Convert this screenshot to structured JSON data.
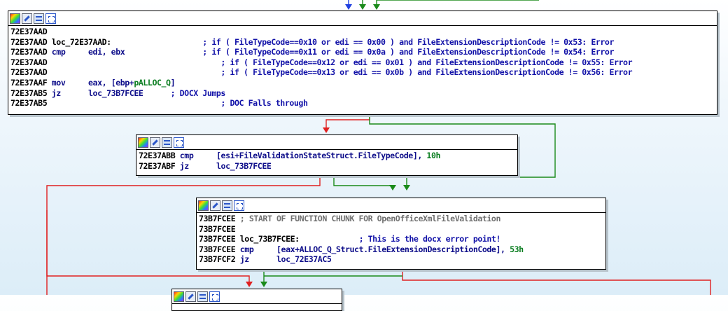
{
  "app": {
    "view": "IDA graph view"
  },
  "colors": {
    "edge_true": "#1a8a1a",
    "edge_false": "#e02020",
    "edge_flow": "#2040e0",
    "comment": "#1212a8",
    "number": "#0a7d20",
    "function_chunk": "#707070"
  },
  "icons": [
    "node-color-icon",
    "rename-node-icon",
    "graph-overview-icon",
    "group-nodes-icon"
  ],
  "nodes": [
    {
      "name": "node-72E37AAD",
      "lines": [
        [
          {
            "t": "72E37AAD"
          }
        ],
        [
          {
            "t": "72E37AAD "
          },
          {
            "t": "loc_72E37AAD:"
          },
          {
            "t": "                    "
          },
          {
            "t": "; if ( FileTypeCode==0x10 or edi == 0x00 ) and FileExtensionDescriptionCode != 0x53: Error",
            "c": "blue"
          }
        ],
        [
          {
            "t": "72E37AAD "
          },
          {
            "t": "cmp",
            "c": "mnem"
          },
          {
            "t": "     edi, ebx",
            "c": "mnem"
          },
          {
            "t": "                 "
          },
          {
            "t": "; if ( FileTypeCode==0x11 or edi == 0x0a ) and FileExtensionDescriptionCode != 0x54: Error",
            "c": "blue"
          }
        ],
        [
          {
            "t": "72E37AAD"
          },
          {
            "t": "                                      "
          },
          {
            "t": "; if ( FileTypeCode==0x12 or edi == 0x01 ) and FileExtensionDescriptionCode != 0x55: Error",
            "c": "blue"
          }
        ],
        [
          {
            "t": "72E37AAD"
          },
          {
            "t": "                                      "
          },
          {
            "t": "; if ( FileTypeCode==0x13 or edi == 0x0b ) and FileExtensionDescriptionCode != 0x56: Error",
            "c": "blue"
          }
        ],
        [
          {
            "t": "72E37AAF "
          },
          {
            "t": "mov",
            "c": "mnem"
          },
          {
            "t": "     eax, [ebp+",
            "c": "mnem"
          },
          {
            "t": "pALLOC_Q",
            "c": "num"
          },
          {
            "t": "]",
            "c": "mnem"
          }
        ],
        [
          {
            "t": "72E37AB5 "
          },
          {
            "t": "jz",
            "c": "mnem"
          },
          {
            "t": "      loc_73B7FCEE",
            "c": "mnem"
          },
          {
            "t": "      "
          },
          {
            "t": "; DOCX Jumps",
            "c": "blue"
          }
        ],
        [
          {
            "t": "72E37AB5"
          },
          {
            "t": "                                      "
          },
          {
            "t": "; DOC Falls through",
            "c": "blue"
          }
        ]
      ]
    },
    {
      "name": "node-72E37ABB",
      "lines": [
        [
          {
            "t": "72E37ABB "
          },
          {
            "t": "cmp",
            "c": "mnem"
          },
          {
            "t": "     [esi+FileValidationStateStruct.FileTypeCode], ",
            "c": "mnem"
          },
          {
            "t": "10h",
            "c": "num"
          }
        ],
        [
          {
            "t": "72E37ABF "
          },
          {
            "t": "jz",
            "c": "mnem"
          },
          {
            "t": "      loc_73B7FCEE",
            "c": "mnem"
          }
        ]
      ]
    },
    {
      "name": "node-73B7FCEE",
      "lines": [
        [
          {
            "t": "73B7FCEE "
          },
          {
            "t": "; START OF FUNCTION CHUNK FOR OpenOfficeXmlFileValidation",
            "c": "grey"
          }
        ],
        [
          {
            "t": "73B7FCEE"
          }
        ],
        [
          {
            "t": "73B7FCEE "
          },
          {
            "t": "loc_73B7FCEE:"
          },
          {
            "t": "             "
          },
          {
            "t": "; This is the docx error point!",
            "c": "blue"
          }
        ],
        [
          {
            "t": "73B7FCEE "
          },
          {
            "t": "cmp",
            "c": "mnem"
          },
          {
            "t": "     [eax+ALLOC_Q_Struct.FileExtensionDescriptionCode], ",
            "c": "mnem"
          },
          {
            "t": "53h",
            "c": "num"
          }
        ],
        [
          {
            "t": "73B7FCF2 "
          },
          {
            "t": "jz",
            "c": "mnem"
          },
          {
            "t": "      loc_72E37AC5",
            "c": "mnem"
          }
        ]
      ]
    },
    {
      "name": "node-next",
      "lines": []
    }
  ]
}
